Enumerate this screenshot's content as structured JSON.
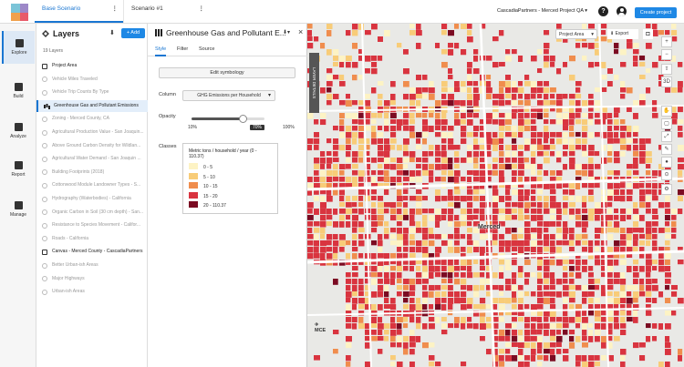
{
  "colors": {
    "accent": "#1976d2",
    "button": "#1e88e5"
  },
  "tabs": [
    {
      "label": "Base Scenario"
    },
    {
      "label": "Scenario #1"
    }
  ],
  "header": {
    "project": "CascadiaPartners - Merced Project QA",
    "help": "?",
    "create_label": "Create project"
  },
  "nav": [
    {
      "label": "Explore",
      "icon": "map-icon"
    },
    {
      "label": "Build",
      "icon": "building-icon"
    },
    {
      "label": "Analyze",
      "icon": "chart-icon"
    },
    {
      "label": "Report",
      "icon": "report-icon"
    },
    {
      "label": "Manage",
      "icon": "folder-icon"
    }
  ],
  "layers": {
    "title": "Layers",
    "add_label": "+ Add",
    "count": "19 Layers",
    "items": [
      {
        "label": "Project Area",
        "group": true
      },
      {
        "label": "Vehicle Miles Traveled"
      },
      {
        "label": "Vehicle Trip Counts By Type"
      },
      {
        "label": "Greenhouse Gas and Pollutant Emissions",
        "selected": true
      },
      {
        "label": "Zoning - Merced County, CA"
      },
      {
        "label": "Agricultural Production Value - San Joaquin..."
      },
      {
        "label": "Above Ground Carbon Density for Wildlan..."
      },
      {
        "label": "Agricultural Water Demand - San Joaquin ..."
      },
      {
        "label": "Building Footprints (2018)"
      },
      {
        "label": "Cottonwood Module Landowner Types - S..."
      },
      {
        "label": "Hydrography (Waterbodies) - California"
      },
      {
        "label": "Organic Carbon in Soil (30 cm depth) - San..."
      },
      {
        "label": "Resistance to Species Movement - Califor..."
      },
      {
        "label": "Roads - California"
      },
      {
        "label": "Canvas - Merced County - CascadiaPartners",
        "group": true
      },
      {
        "label": "Better Urban-ish Areas"
      },
      {
        "label": "Major Highways"
      },
      {
        "label": "Urban-ish Areas"
      }
    ]
  },
  "panel": {
    "title": "Greenhouse Gas and Pollutant E...",
    "tabs": [
      "Style",
      "Filter",
      "Source"
    ],
    "edit_label": "Edit symbology",
    "column_label": "Column",
    "column_value": "GHG Emissions per Household",
    "opacity_label": "Opacity",
    "opacity_value": 0.7,
    "opacity_min": "10%",
    "opacity_current": "70%",
    "opacity_max": "100%",
    "classes_label": "Classes",
    "classes_title": "Metric tons / household / year (0 - 110.37)",
    "classes": [
      {
        "label": "0 - 5",
        "color": "#fdf3c4"
      },
      {
        "label": "5 - 10",
        "color": "#f8cc78"
      },
      {
        "label": "10 - 15",
        "color": "#f08d4d"
      },
      {
        "label": "15 - 20",
        "color": "#d9343f"
      },
      {
        "label": "20 - 110.37",
        "color": "#7b0b22"
      }
    ]
  },
  "map": {
    "lateral_label": "LAYER DETAILS",
    "area_select": "Project Area",
    "export_label": "Export",
    "tools": [
      "+",
      "−",
      "⇧",
      "3D",
      "✋",
      "▢",
      "⤢",
      "✎",
      "●",
      "⊙",
      "⚙"
    ],
    "city_label": "Merced",
    "airport_label": "MCE"
  }
}
